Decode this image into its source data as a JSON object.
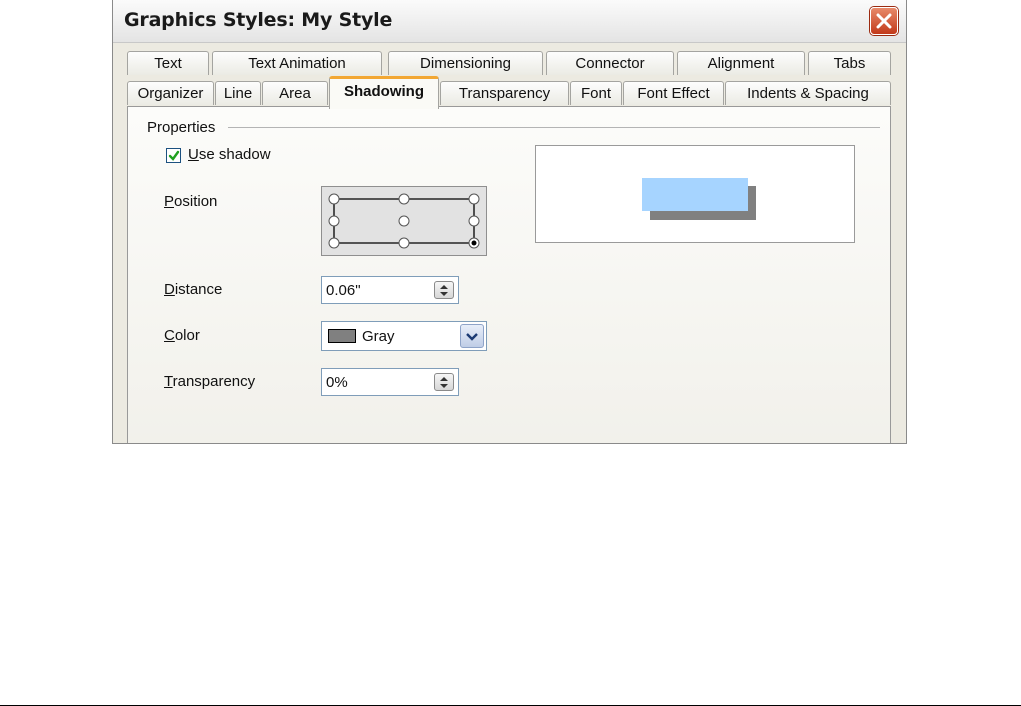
{
  "window": {
    "title": "Graphics Styles: My Style"
  },
  "tabs": {
    "row1": [
      "Text",
      "Text Animation",
      "Dimensioning",
      "Connector",
      "Alignment",
      "Tabs"
    ],
    "row2": [
      "Organizer",
      "Line",
      "Area",
      "Shadowing",
      "Transparency",
      "Font",
      "Font Effect",
      "Indents & Spacing"
    ],
    "active": "Shadowing"
  },
  "properties": {
    "section_label": "Properties",
    "use_shadow": {
      "pre": "",
      "key": "U",
      "rest": "se shadow",
      "checked": true
    },
    "position": {
      "pre": "",
      "key": "P",
      "rest": "osition",
      "selected": "bottom-right"
    },
    "distance": {
      "pre": "",
      "key": "D",
      "rest": "istance",
      "value": "0.06\""
    },
    "color": {
      "pre": "",
      "key": "C",
      "rest": "olor",
      "value": "Gray",
      "swatch": "#808080"
    },
    "transparency": {
      "pre": "",
      "key": "T",
      "rest": "ransparency",
      "value": "0%"
    }
  },
  "colors": {
    "preview_object": "#a6d4ff",
    "preview_shadow": "#808080",
    "accent": "#f2a733"
  }
}
